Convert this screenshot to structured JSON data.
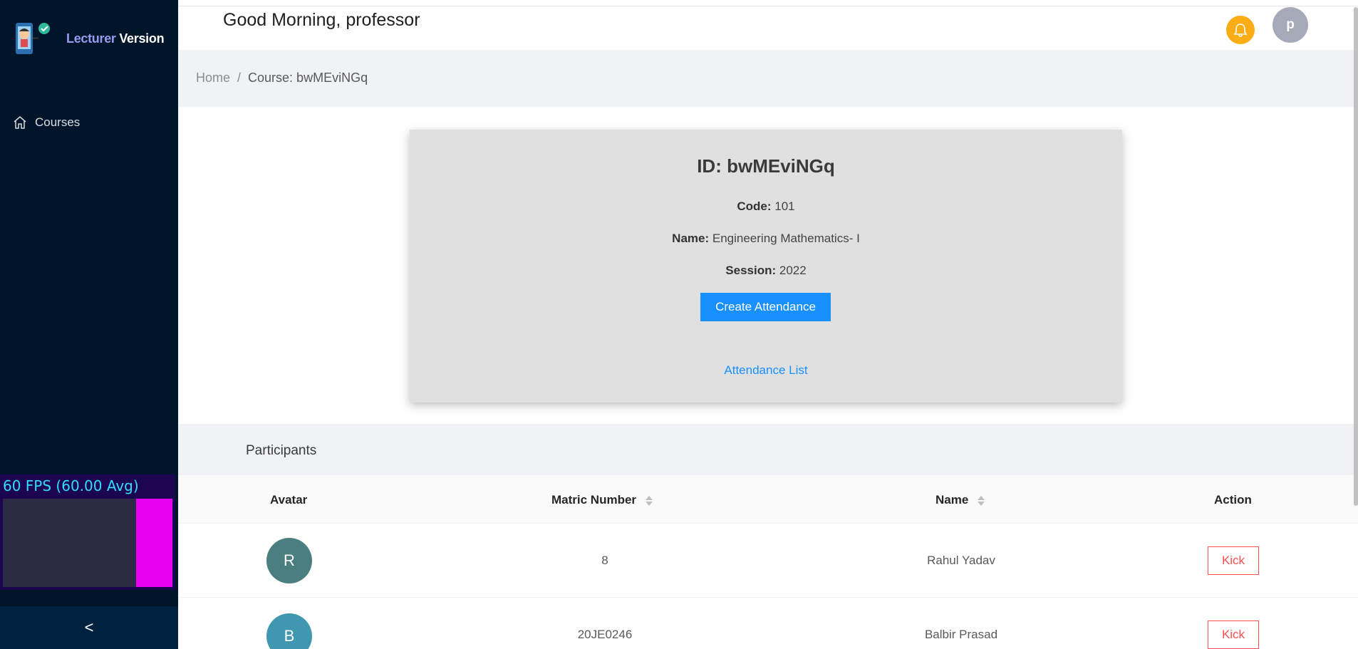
{
  "sidebar": {
    "brand_accent": "Lecturer",
    "brand_rest": "Version",
    "nav": [
      {
        "label": "Courses",
        "icon": "home-icon"
      }
    ],
    "collapse_label": "<"
  },
  "fps_meter": {
    "text": "60 FPS (60.00 Avg)"
  },
  "header": {
    "greeting": "Good Morning, professor",
    "avatar_letter": "p",
    "notification_icon": "bell-icon"
  },
  "breadcrumb": {
    "home": "Home",
    "separator": "/",
    "current": "Course: bwMEviNGq"
  },
  "course": {
    "id_label": "ID:",
    "id": "bwMEviNGq",
    "code_label": "Code:",
    "code": "101",
    "name_label": "Name:",
    "name": "Engineering Mathematics- I",
    "session_label": "Session:",
    "session": "2022",
    "create_button": "Create Attendance",
    "attendance_link": "Attendance List"
  },
  "participants": {
    "title": "Participants",
    "columns": [
      "Avatar",
      "Matric Number",
      "Name",
      "Action"
    ],
    "rows": [
      {
        "initial": "R",
        "matric": "8",
        "name": "Rahul Yadav",
        "action": "Kick",
        "avatar_color": "#4b7f7f"
      },
      {
        "initial": "B",
        "matric": "20JE0246",
        "name": "Balbir Prasad",
        "action": "Kick",
        "avatar_color": "#3f98b0"
      }
    ]
  },
  "colors": {
    "sidebar": "#001529",
    "primary": "#1890ff",
    "danger": "#ff4d4f",
    "bell": "#faad14"
  }
}
